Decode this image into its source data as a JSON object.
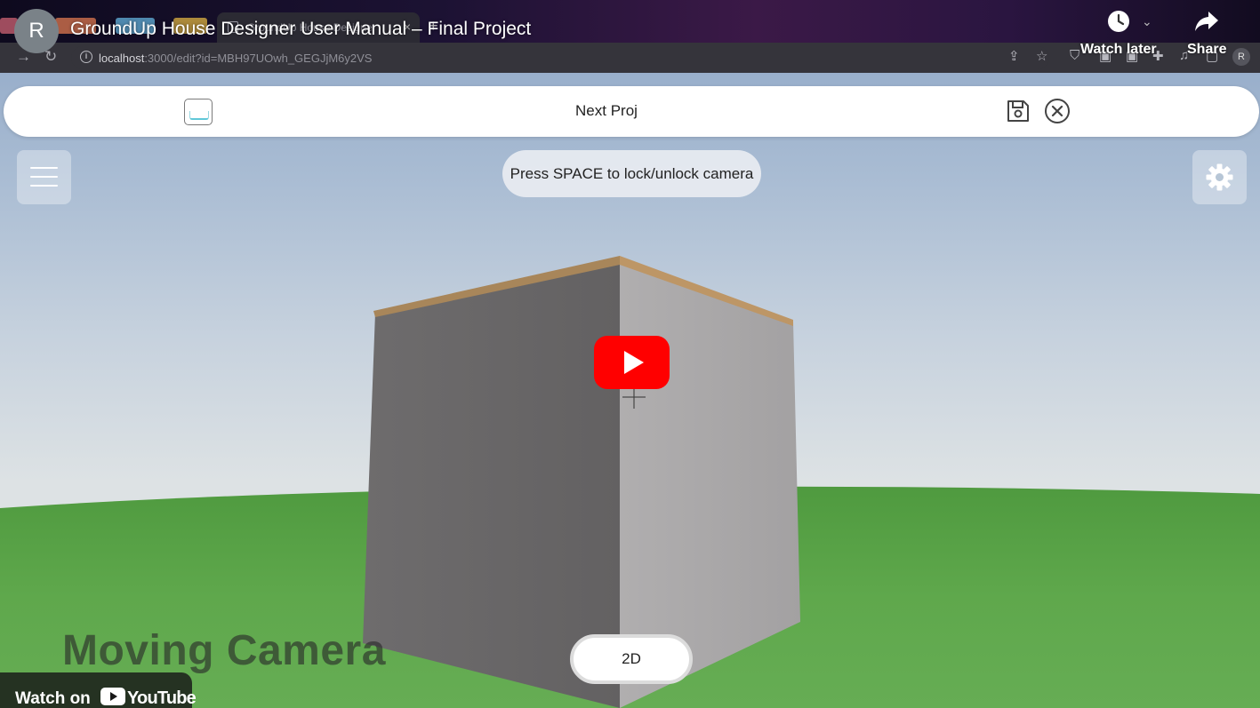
{
  "youtube": {
    "channel_initial": "R",
    "video_title": "GroundUp House Designer User Manual – Final Project",
    "watch_later_label": "Watch later",
    "share_label": "Share",
    "watch_on_label": "Watch on",
    "brand_label": "YouTube"
  },
  "browser": {
    "active_tab_title": "GroundUp House Designer",
    "url_host": "localhost",
    "url_path": ":3000/edit?id=MBH97UOwh_GEGJjM6y2VS",
    "profile_initial": "R"
  },
  "app": {
    "project_name": "Next Proj",
    "hint_text": "Press SPACE to lock/unlock camera",
    "view_toggle_label": "2D",
    "section_caption": "Moving Camera"
  },
  "colors": {
    "youtube_red": "#ff0000",
    "grass": "#5da64a",
    "wall_dark": "#656364",
    "wall_light": "#a9a7a8",
    "roof_trim": "#b48c5a"
  }
}
